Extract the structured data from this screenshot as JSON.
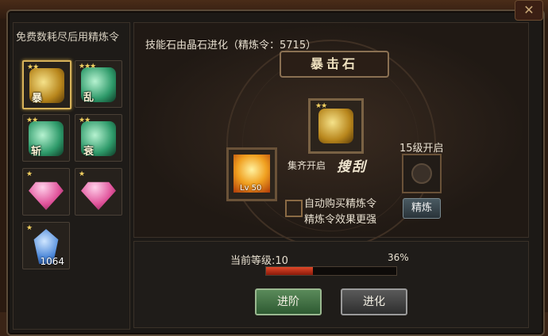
{
  "left_panel": {
    "title": "免费数耗尽后用精炼令",
    "slots": [
      {
        "stars": "★★",
        "glyph": "暴",
        "color": "gold",
        "selected": true
      },
      {
        "stars": "★★★",
        "glyph": "乱",
        "color": "green",
        "selected": false
      },
      {
        "stars": "★★",
        "glyph": "斩",
        "color": "green",
        "selected": false
      },
      {
        "stars": "★★",
        "glyph": "衰",
        "color": "green",
        "selected": false
      },
      {
        "stars": "★",
        "glyph": "",
        "color": "pink",
        "selected": false
      },
      {
        "stars": "★",
        "glyph": "",
        "color": "pink",
        "selected": false
      },
      {
        "stars": "★",
        "glyph": "",
        "color": "blue",
        "quantity": "1064",
        "selected": false
      }
    ]
  },
  "main": {
    "info_text": "技能石由晶石进化（精炼令：5715）",
    "stone_name": "暴击石",
    "center_stone": {
      "stars": "★★"
    },
    "side_skill_level": "Lv 50",
    "gather_text": "集齐开启",
    "skill_name": "搜刮",
    "unlock_text": "15级开启",
    "refine_button": "精炼",
    "auto_buy_line1": "自动购买精炼令",
    "auto_buy_line2": "精炼令效果更强"
  },
  "bottom": {
    "current_level_text": "当前等级:10",
    "progress_text": "36%",
    "progress_value": 36,
    "advance_button": "进阶",
    "evolve_button": "进化"
  },
  "colors": {
    "panel_bg": "#1c1916",
    "border": "#5a4a38",
    "progress_fill": "#e04828",
    "advance_btn": "#3e6e42",
    "evolve_btn": "#444444"
  }
}
